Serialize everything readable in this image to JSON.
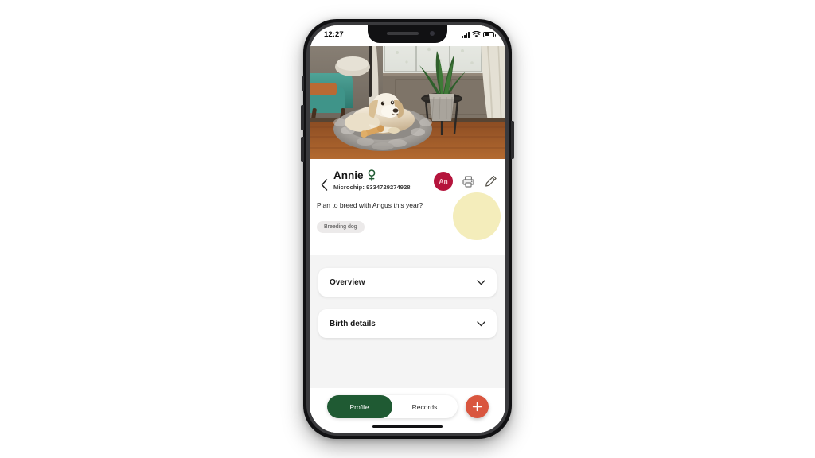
{
  "device": {
    "status_bar": {
      "time": "12:27",
      "signal_icon": "cellular-bars-icon",
      "wifi_icon": "wifi-icon",
      "battery_icon": "battery-icon"
    },
    "home_indicator": "home-indicator"
  },
  "hero": {
    "photo_alt": "Golden retriever lying on a grey fluffy round dog bed in a living room with a teal armchair, snake plant and window"
  },
  "header": {
    "back_icon": "chevron-left-icon",
    "pet_name": "Annie",
    "sex_symbol": "♀",
    "microchip": "Microchip: 9334729274928",
    "avatar_initials": "An",
    "print_icon": "printer-icon",
    "edit_icon": "pencil-icon",
    "note": "Plan to breed with Angus this year?",
    "tags": [
      "Breeding dog"
    ]
  },
  "content": {
    "sections": [
      {
        "title": "Overview",
        "chevron": "chevron-down-icon"
      },
      {
        "title": "Birth details",
        "chevron": "chevron-down-icon"
      }
    ]
  },
  "bottom": {
    "tabs": [
      {
        "label": "Profile",
        "active": true
      },
      {
        "label": "Records",
        "active": false
      }
    ],
    "fab_label": "+",
    "fab_icon": "plus-icon"
  },
  "colors": {
    "brand_green": "#1f5a33",
    "avatar_crimson": "#b5143c",
    "fab_terracotta": "#d9563f",
    "spotlight_yellow": "#f4edbb",
    "content_bg": "#f4f4f4",
    "chip_grey": "#eceaea"
  }
}
